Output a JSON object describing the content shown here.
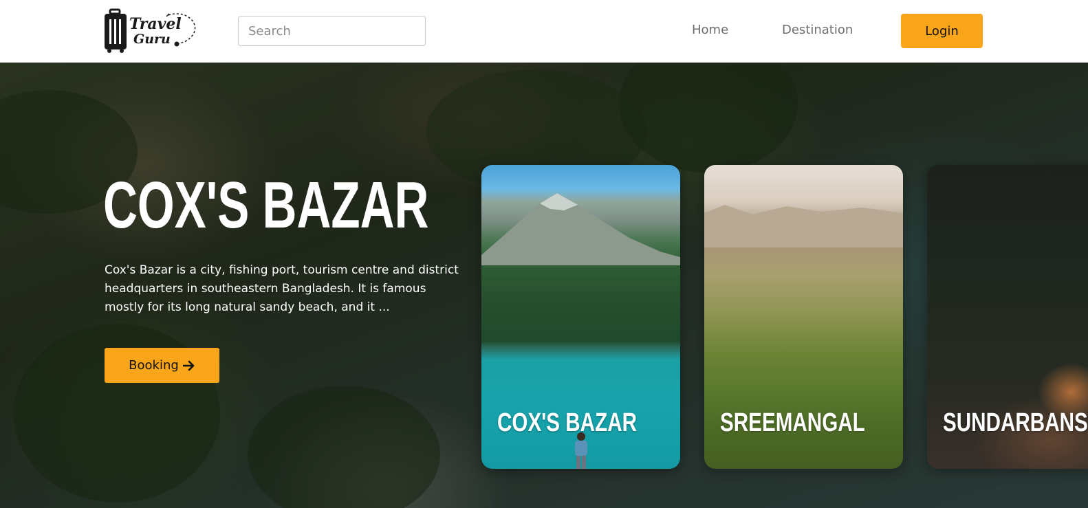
{
  "brand": {
    "line1": "Travel",
    "line2": "Guru",
    "icon": "suitcase-icon"
  },
  "search": {
    "placeholder": "Search",
    "value": ""
  },
  "nav": {
    "home": "Home",
    "destination": "Destination",
    "login": "Login"
  },
  "hero": {
    "title": "COX'S BAZAR",
    "description": "Cox's Bazar is a city, fishing port, tourism centre and district headquarters in southeastern Bangladesh. It is famous mostly for its long natural sandy beach, and it ...",
    "booking_label": "Booking",
    "booking_icon": "arrow-right-icon"
  },
  "cards": [
    {
      "label": "COX'S BAZAR"
    },
    {
      "label": "SREEMANGAL"
    },
    {
      "label": "SUNDARBANS"
    }
  ],
  "colors": {
    "accent": "#f9a51a",
    "nav_text": "#6d6d6d",
    "header_bg": "#ffffff"
  }
}
